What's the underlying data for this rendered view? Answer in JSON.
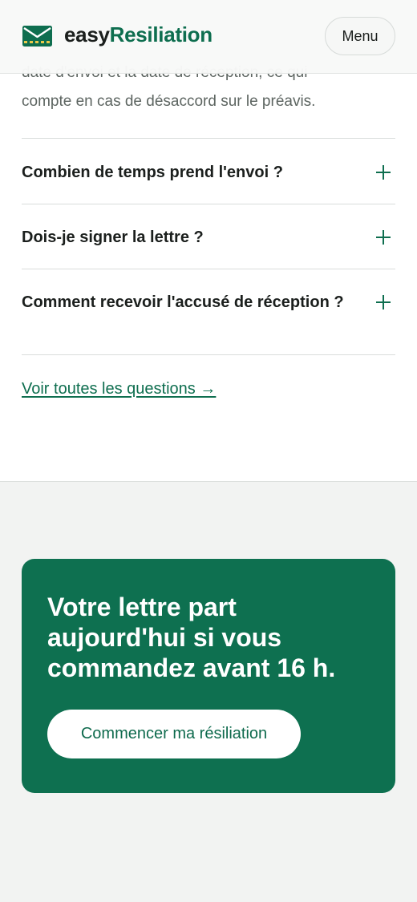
{
  "header": {
    "logo_part1": "easy",
    "logo_part2": "Resiliation",
    "menu_label": "Menu"
  },
  "intro": {
    "line_cut": "date d'envoi et la date de réception, ce qui",
    "line_full": "compte en cas de désaccord sur le préavis."
  },
  "faq": {
    "items": [
      {
        "question": "Combien de temps prend l'envoi ?"
      },
      {
        "question": "Dois-je signer la lettre ?"
      },
      {
        "question": "Comment recevoir l'accusé de réception ?"
      }
    ],
    "all_link": "Voir toutes les questions →"
  },
  "cta": {
    "title": "Votre lettre part aujourd'hui si vous commandez avant 16 h.",
    "button_label": "Commencer ma résiliation"
  },
  "colors": {
    "brand_green": "#0e7050",
    "text_dark": "#1b1f1d",
    "text_muted": "#5d6561",
    "section_bg": "#f2f3f2"
  }
}
